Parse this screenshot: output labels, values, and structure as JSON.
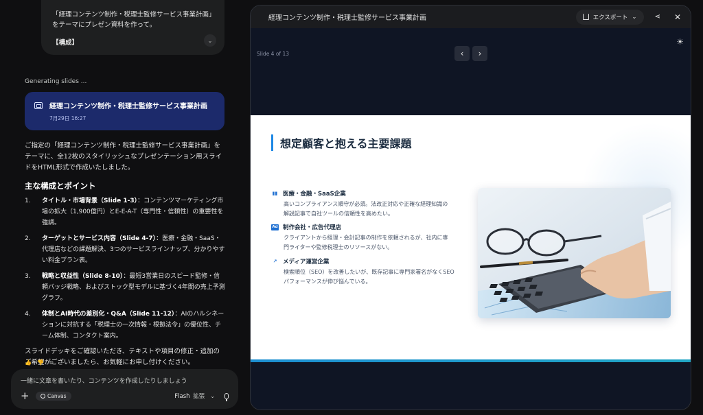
{
  "chat": {
    "prompt_line1": "「経理コンテンツ制作・税理士監修サービス事業計画」",
    "prompt_line2": "をテーマにプレゼン資料を作って。",
    "prompt_section": "【構成】",
    "status": "Generating slides ...",
    "doc_card": {
      "title": "経理コンテンツ制作・税理士監修サービス事業計画",
      "date": "7月29日 16:27"
    },
    "intro": "ご指定の「経理コンテンツ制作・税理士監修サービス事業計画」をテーマに、全12枚のスタイリッシュなプレゼンテーション用スライドをHTML形式で作成いたしました。",
    "heading": "主な構成とポイント",
    "points": [
      {
        "num": "1.",
        "bold": "タイトル・市場背景（Slide 1-3）",
        "text": "：コンテンツマーケティング市場の拡大（1,900億円）とE-E-A-T（専門性・信頼性）の重要性を強調。"
      },
      {
        "num": "2.",
        "bold": "ターゲットとサービス内容（Slide 4-7）",
        "text": "：医療・金融・SaaS・代理店などの課題解決、3つのサービスラインナップ、分かりやすい料金プラン表。"
      },
      {
        "num": "3.",
        "bold": "戦略と収益性（Slide 8-10）",
        "text": "：最短3営業日のスピード監修・信頼バッジ戦略、およびストック型モデルに基づく4年間の売上予測グラフ。"
      },
      {
        "num": "4.",
        "bold": "体制とAI時代の差別化・Q&A（Slide 11-12）",
        "text": "：AIのハルシネーションに対抗する「税理士の一次情報・根拠法令」の優位性、チーム体制、コンタクト案内。"
      }
    ],
    "closing": "スライドデッキをご確認いただき、テキストや項目の修正・追加のご希望がございましたら、お気軽にお申し付けください。",
    "input_placeholder": "一緒に文章を書いたり、コンテンツを作成したりしましょう",
    "canvas_chip": "Canvas",
    "model": "Flash",
    "model_tool": "拡張"
  },
  "canvas": {
    "title": "経理コンテンツ制作・税理士監修サービス事業計画",
    "export_label": "エクスポート",
    "slide_counter": "Slide 4 of 13",
    "slide": {
      "title": "想定顧客と抱える主要課題",
      "segments": [
        {
          "icon": "building-icon",
          "glyph": "▮▮",
          "title": "医療・金融・SaaS企業",
          "lines": [
            "高いコンプライアンス順守が必須。法改正対応や正確な経理知識の",
            "解説記事で自社ツールの信頼性を高めたい。"
          ]
        },
        {
          "icon": "ad-icon",
          "glyph": "Ad",
          "title": "制作会社・広告代理店",
          "lines": [
            "クライアントから経理・会計記事の制作を依頼されるが、社内に専",
            "門ライターや監修税理士のリソースがない。"
          ]
        },
        {
          "icon": "trend-icon",
          "glyph": "↗",
          "title": "メディア運営企業",
          "lines": [
            "検索順位（SEO）を改善したいが、既存記事に専門家署名がなくSEO",
            "パフォーマンスが伸び悩んでいる。"
          ]
        }
      ]
    }
  },
  "colors": {
    "accent": "#1e88e5",
    "doc_card_bg": "#1c2a6b",
    "slide_bar": "#1c8ed1"
  }
}
